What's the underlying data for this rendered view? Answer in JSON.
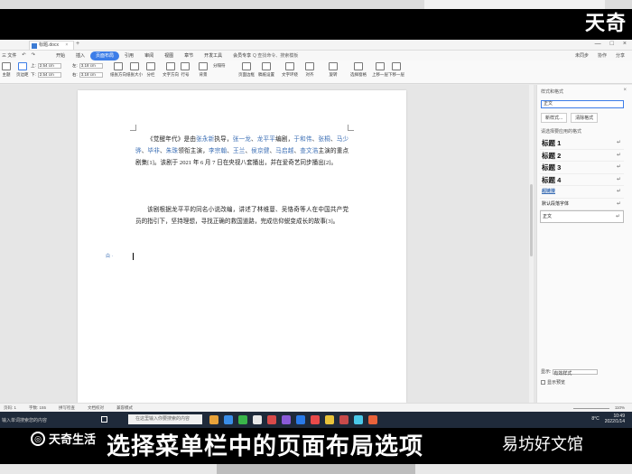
{
  "watermark": "天奇",
  "titlebar": {
    "doc_tab": "标题.docx",
    "tab_close": "×",
    "tab_add": "+",
    "win_controls": [
      "—",
      "□",
      "×"
    ]
  },
  "menubar": {
    "left_items": [
      "三 文件",
      "↶",
      "↷"
    ],
    "tabs": [
      "开始",
      "插入",
      "页面布局",
      "引用",
      "审阅",
      "视图",
      "章节",
      "开发工具",
      "会员专享"
    ],
    "active_tab": 2,
    "search": "Q 查找命令、搜索模板",
    "right_items": [
      "未同步",
      "协作",
      "分享"
    ]
  },
  "ribbon": {
    "buttons": [
      {
        "name": "theme",
        "label": "主题"
      },
      {
        "name": "margins",
        "label": "页边距"
      },
      {
        "name": "orientation",
        "label": "纸张方向"
      },
      {
        "name": "size",
        "label": "纸张大小"
      },
      {
        "name": "columns",
        "label": "分栏"
      },
      {
        "name": "text-direction",
        "label": "文字方向"
      },
      {
        "name": "line-number",
        "label": "行号"
      },
      {
        "name": "background",
        "label": "背景"
      },
      {
        "name": "page-border",
        "label": "页面边框"
      },
      {
        "name": "draft-paper",
        "label": "稿纸设置"
      },
      {
        "name": "wrap",
        "label": "文字环绕"
      },
      {
        "name": "align",
        "label": "对齐"
      },
      {
        "name": "rotate",
        "label": "旋转"
      },
      {
        "name": "select-pane",
        "label": "选择窗格"
      },
      {
        "name": "up-layer",
        "label": "上移一层"
      },
      {
        "name": "down-layer",
        "label": "下移一层"
      }
    ],
    "margin_fields": [
      {
        "label": "上:",
        "value": "2.54 cm"
      },
      {
        "label": "下:",
        "value": "2.54 cm"
      },
      {
        "label": "左:",
        "value": "3.18 cm"
      },
      {
        "label": "右:",
        "value": "3.18 cm"
      }
    ],
    "separator": "分隔符"
  },
  "document": {
    "para1_parts": [
      {
        "t": "《觉醒年代》是由",
        "c": "n"
      },
      {
        "t": "张永新",
        "c": "b"
      },
      {
        "t": "执导，",
        "c": "n"
      },
      {
        "t": "张一龙",
        "c": "b"
      },
      {
        "t": "、",
        "c": "n"
      },
      {
        "t": "龙平平",
        "c": "b"
      },
      {
        "t": "编剧，",
        "c": "n"
      },
      {
        "t": "于和伟",
        "c": "b"
      },
      {
        "t": "、",
        "c": "n"
      },
      {
        "t": "张桐",
        "c": "b"
      },
      {
        "t": "、",
        "c": "n"
      },
      {
        "t": "马少骅",
        "c": "b"
      },
      {
        "t": "、",
        "c": "n"
      },
      {
        "t": "毕非",
        "c": "b"
      },
      {
        "t": "、",
        "c": "n"
      },
      {
        "t": "朱珠",
        "c": "b"
      },
      {
        "t": "领衔主演，",
        "c": "n"
      },
      {
        "t": "李宗翰",
        "c": "b"
      },
      {
        "t": "、",
        "c": "n"
      },
      {
        "t": "王兰",
        "c": "b"
      },
      {
        "t": "、",
        "c": "n"
      },
      {
        "t": "侯京健",
        "c": "b"
      },
      {
        "t": "、",
        "c": "n"
      },
      {
        "t": "马启越",
        "c": "b"
      },
      {
        "t": "、",
        "c": "n"
      },
      {
        "t": "查文浩",
        "c": "b"
      },
      {
        "t": "主演的重点剧集[1]。该剧于 2021 年 6 月 7 日在央视八套播出，并在爱奇艺同步播出[2]。",
        "c": "n"
      }
    ],
    "para2": "该剧根据龙平平的同名小说改编，讲述了林维蔓、吴恪奇等人在中国共产党员的指引下，坚持理想，寻找正确的救国道路，完成信仰蜕变成长的故事[3]。",
    "margin_mark": "白 ·"
  },
  "styles_panel": {
    "title": "样式和格式",
    "current": "正文",
    "btn_new": "新样式...",
    "btn_clear": "清除格式",
    "subtitle": "请选择要应用的格式",
    "items": [
      {
        "label": "标题 1",
        "kind": "heading"
      },
      {
        "label": "标题 2",
        "kind": "heading"
      },
      {
        "label": "标题 3",
        "kind": "heading"
      },
      {
        "label": "标题 4",
        "kind": "heading"
      },
      {
        "label": "超链接",
        "kind": "link"
      },
      {
        "label": "默认段落字体",
        "kind": "small"
      },
      {
        "label": "正文",
        "kind": "boxed"
      }
    ],
    "return_glyph": "↵",
    "show_label": "显示:",
    "show_value": "有效样式",
    "preview_label": "显示预览"
  },
  "statusbar": {
    "left": [
      "页码: 1",
      "字数: 155",
      "拼写检查",
      "文档校对",
      "兼容模式"
    ],
    "zoom": "110%"
  },
  "taskbar": {
    "hint": "输入单词搜索您的内容",
    "search_placeholder": "在这里输入你要搜索的内容",
    "app_colors": [
      "#e8a23a",
      "#3a8ee8",
      "#3ab54a",
      "#e8e8e8",
      "#d84a4a",
      "#8a5ad8",
      "#2a7ae8",
      "#e84a4a",
      "#e8c23a",
      "#c84a4a",
      "#4ac8e8",
      "#e8623a"
    ],
    "weather": "8°C",
    "time": "10:49",
    "date": "2022/1/14"
  },
  "bottom": {
    "brand": "天奇生活",
    "subtitle": "选择菜单栏中的页面布局选项",
    "credit": "易坊好文馆"
  }
}
